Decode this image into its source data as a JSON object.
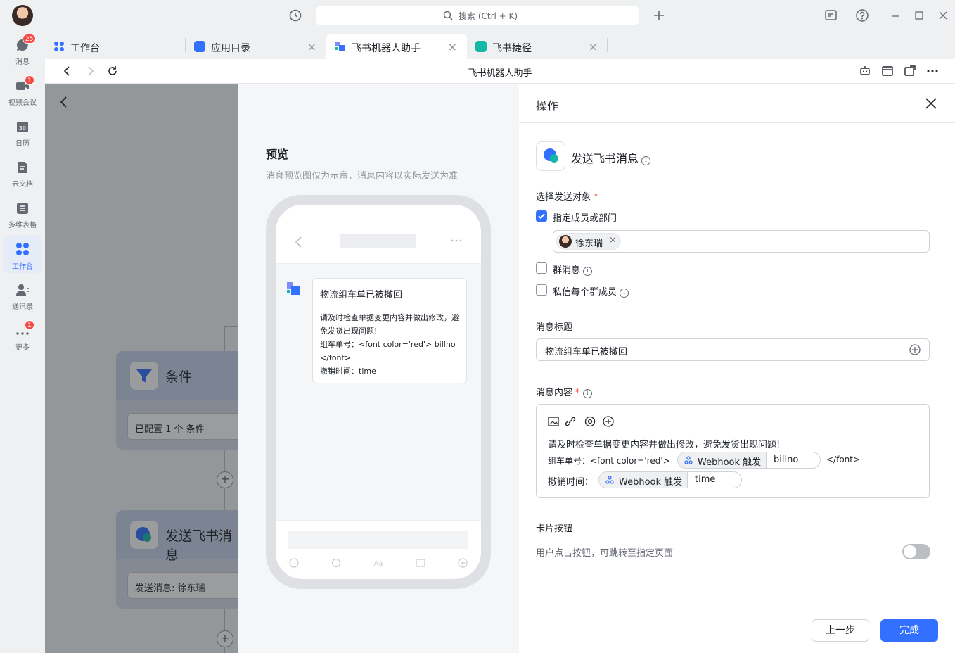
{
  "sidebar": {
    "items": [
      {
        "label": "消息",
        "badge": "25"
      },
      {
        "label": "视频会议",
        "badge": "1"
      },
      {
        "label": "日历",
        "icon_text": "30"
      },
      {
        "label": "云文档"
      },
      {
        "label": "多维表格"
      },
      {
        "label": "工作台"
      },
      {
        "label": "通讯录"
      },
      {
        "label": "更多",
        "badge": "1"
      }
    ]
  },
  "titlebar": {
    "search_placeholder": "搜索 (Ctrl + K)"
  },
  "tabs": [
    {
      "label": "工作台"
    },
    {
      "label": "应用目录"
    },
    {
      "label": "飞书机器人助手"
    },
    {
      "label": "飞书捷径"
    }
  ],
  "address": {
    "title": "飞书机器人助手"
  },
  "flow": {
    "condition_title": "条件",
    "condition_field": "已配置 1 个 条件",
    "send_title": "发送飞书消息",
    "send_field": "发送消息: 徐东瑞"
  },
  "preview": {
    "title": "预览",
    "subtitle": "消息预览图仅为示意，消息内容以实际发送为准",
    "message_title": "物流组车单已被撤回",
    "message_line1": "请及时检查单据变更内容并做出修改，避免发货出现问题!",
    "message_line2": "组车单号：<font color='red'> billno </font>",
    "message_line3": "撤销时间：time"
  },
  "panel": {
    "header": "操作",
    "action_title": "发送飞书消息",
    "target_label": "选择发送对象",
    "required_mark": "*",
    "option_members": "指定成员或部门",
    "member_chip": "徐东瑞",
    "option_group": "群消息",
    "option_private": "私信每个群成员",
    "msg_title_label": "消息标题",
    "msg_title_value": "物流组车单已被撤回",
    "msg_content_label": "消息内容",
    "content_line1": "请及时检查单据变更内容并做出修改，避免发货出现问题!",
    "content_line2_prefix": "组车单号：<font color='red'>",
    "content_line2_suffix": "</font>",
    "content_line3_prefix": "撤销时间：",
    "webhook_label": "Webhook 触发",
    "var_billno": "billno",
    "var_time": "time",
    "card_button_label": "卡片按钮",
    "card_button_desc": "用户点击按钮，可跳转至指定页面",
    "card_button_enabled": false,
    "prev_button": "上一步",
    "done_button": "完成"
  },
  "colors": {
    "accent": "#3370ff",
    "badge": "#f54a45",
    "teal": "#14b8a6"
  }
}
